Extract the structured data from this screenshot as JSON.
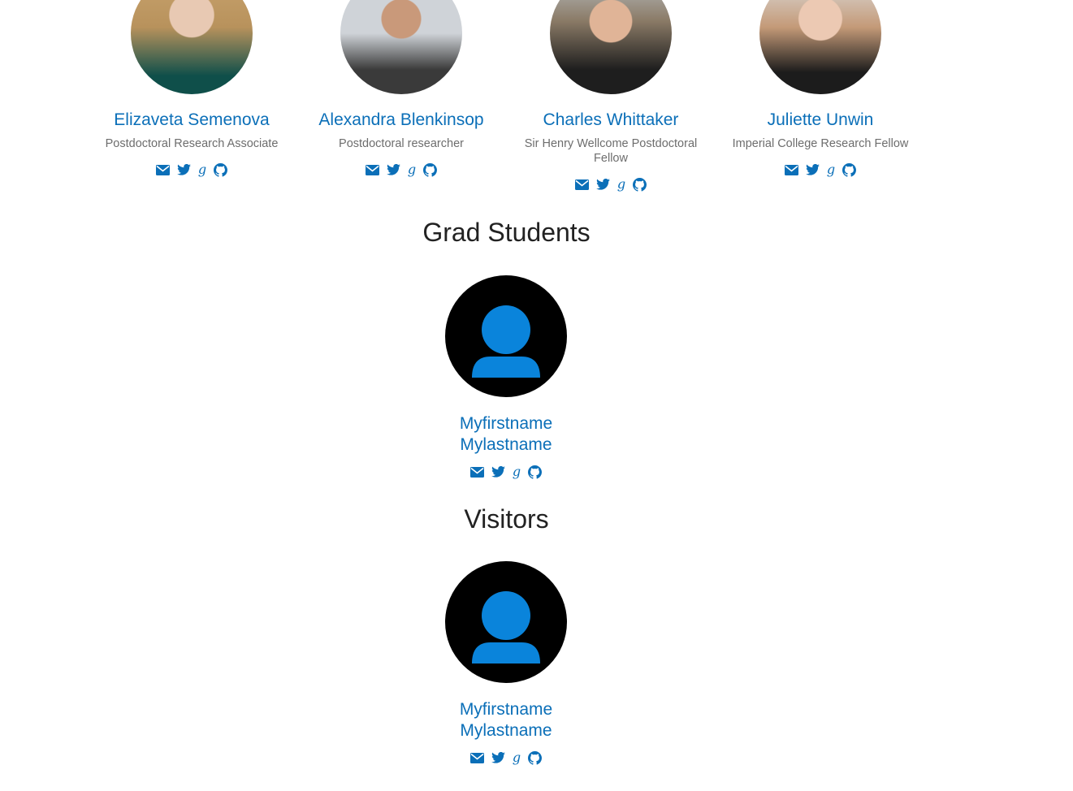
{
  "postdocs": [
    {
      "name": "Elizaveta Semenova",
      "role": "Postdoctoral Research Associate"
    },
    {
      "name": "Alexandra Blenkinsop",
      "role": "Postdoctoral researcher"
    },
    {
      "name": "Charles Whittaker",
      "role": "Sir Henry Wellcome Postdoctoral Fellow"
    },
    {
      "name": "Juliette Unwin",
      "role": "Imperial College Research Fellow"
    }
  ],
  "grad_students": {
    "heading": "Grad Students",
    "members": [
      {
        "first": "Myfirstname",
        "last": "Mylastname"
      }
    ]
  },
  "visitors": {
    "heading": "Visitors",
    "members": [
      {
        "first": "Myfirstname",
        "last": "Mylastname"
      }
    ]
  },
  "icons": {
    "email": "envelope-icon",
    "twitter": "twitter-icon",
    "scholar": "google-scholar-icon",
    "github": "github-icon",
    "placeholder": "user-placeholder-icon"
  },
  "colors": {
    "link": "#0b6fb8",
    "role_text": "#6d6d6d",
    "heading": "#222222",
    "placeholder_bg": "#000000",
    "placeholder_figure": "#0a84db"
  }
}
